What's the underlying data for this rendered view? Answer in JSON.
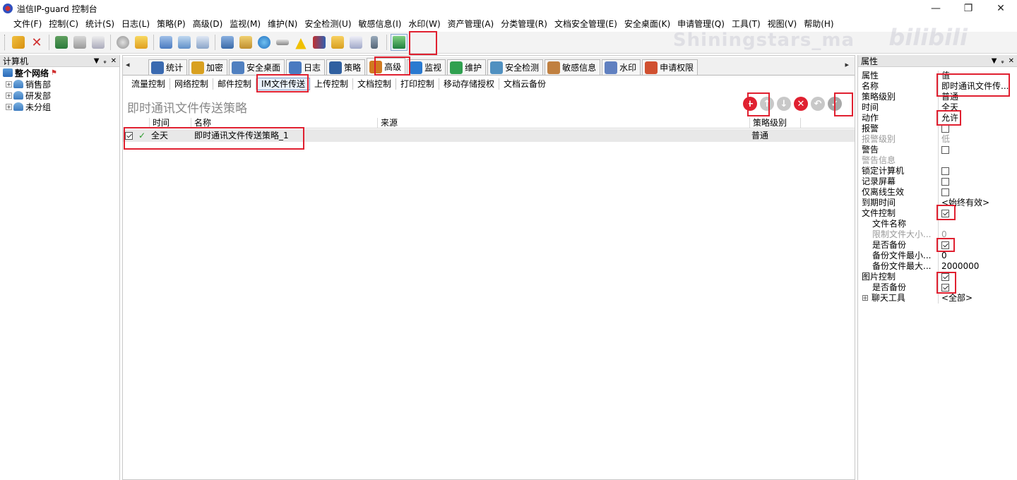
{
  "window": {
    "title": "溢信IP-guard 控制台",
    "controls": [
      "—",
      "❐",
      "✕"
    ]
  },
  "menu": [
    "文件(F)",
    "控制(C)",
    "统计(S)",
    "日志(L)",
    "策略(P)",
    "高级(D)",
    "监视(M)",
    "维护(N)",
    "安全检测(U)",
    "敏感信息(I)",
    "水印(W)",
    "资产管理(A)",
    "分类管理(R)",
    "文档安全管理(E)",
    "安全桌面(K)",
    "申请管理(Q)",
    "工具(T)",
    "视图(V)",
    "帮助(H)"
  ],
  "watermark": {
    "text": "Shiningstars_ma",
    "logo": "bilibili"
  },
  "left_panel": {
    "title": "计算机",
    "controls": [
      "▼",
      "ᵩ",
      "✕"
    ],
    "root": "整个网络",
    "groups": [
      "销售部",
      "研发部",
      "未分组"
    ]
  },
  "tabs": [
    {
      "label": "统计",
      "icon": "chart-icon",
      "color": "#3a6ab0"
    },
    {
      "label": "加密",
      "icon": "lock-icon",
      "color": "#d8a020"
    },
    {
      "label": "安全桌面",
      "icon": "desktop-icon",
      "color": "#5080c0"
    },
    {
      "label": "日志",
      "icon": "log-icon",
      "color": "#4a7ac0"
    },
    {
      "label": "策略",
      "icon": "policy-icon",
      "color": "#3060a0"
    },
    {
      "label": "高级",
      "icon": "advanced-icon",
      "color": "#d07a20"
    },
    {
      "label": "监视",
      "icon": "monitor-icon",
      "color": "#2a7ad0"
    },
    {
      "label": "维护",
      "icon": "maintain-icon",
      "color": "#30a050"
    },
    {
      "label": "安全检测",
      "icon": "security-check-icon",
      "color": "#5090c0"
    },
    {
      "label": "敏感信息",
      "icon": "sensitive-icon",
      "color": "#c08040"
    },
    {
      "label": "水印",
      "icon": "watermark-icon",
      "color": "#6080c0"
    },
    {
      "label": "申请权限",
      "icon": "request-icon",
      "color": "#d05030"
    }
  ],
  "subtabs": [
    "流量控制",
    "网络控制",
    "邮件控制",
    "IM文件传送",
    "上传控制",
    "文档控制",
    "打印控制",
    "移动存储授权",
    "文档云备份"
  ],
  "policy": {
    "title": "即时通讯文件传送策略",
    "columns": [
      "时间",
      "名称",
      "来源",
      "策略级别"
    ],
    "rows": [
      {
        "time": "全天",
        "name": "即时通讯文件传送策略_1",
        "source": "",
        "level": "普通"
      }
    ]
  },
  "right_panel": {
    "title": "属性",
    "controls": [
      "▼",
      "ᵩ",
      "✕"
    ],
    "header": {
      "name": "属性",
      "value": "值"
    },
    "rows": [
      {
        "name": "名称",
        "value": "即时通讯文件传...",
        "type": "text"
      },
      {
        "name": "策略级别",
        "value": "普通",
        "type": "text"
      },
      {
        "name": "时间",
        "value": "全天",
        "type": "text"
      },
      {
        "name": "动作",
        "value": "允许",
        "type": "text"
      },
      {
        "name": "报警",
        "value": "",
        "type": "check",
        "checked": false
      },
      {
        "name": "报警级别",
        "value": "低",
        "type": "text",
        "dim": true
      },
      {
        "name": "警告",
        "value": "",
        "type": "check",
        "checked": false
      },
      {
        "name": "警告信息",
        "value": "",
        "type": "text",
        "dim": true
      },
      {
        "name": "锁定计算机",
        "value": "",
        "type": "check",
        "checked": false
      },
      {
        "name": "记录屏幕",
        "value": "",
        "type": "check",
        "checked": false
      },
      {
        "name": "仅离线生效",
        "value": "",
        "type": "check",
        "checked": false
      },
      {
        "name": "到期时间",
        "value": "<始终有效>",
        "type": "text"
      },
      {
        "name": "文件控制",
        "value": "",
        "type": "check",
        "checked": true
      },
      {
        "name": "文件名称",
        "value": "",
        "type": "text",
        "indent": true
      },
      {
        "name": "限制文件大小...",
        "value": "0",
        "type": "text",
        "indent": true,
        "dim": true
      },
      {
        "name": "是否备份",
        "value": "",
        "type": "check",
        "checked": true,
        "indent": true
      },
      {
        "name": "备份文件最小...",
        "value": "0",
        "type": "text",
        "indent": true
      },
      {
        "name": "备份文件最大...",
        "value": "2000000",
        "type": "text",
        "indent": true
      },
      {
        "name": "图片控制",
        "value": "",
        "type": "check",
        "checked": true
      },
      {
        "name": "是否备份",
        "value": "",
        "type": "check",
        "checked": true,
        "indent": true
      },
      {
        "name": "聊天工具",
        "value": "<全部>",
        "type": "text",
        "expand": true
      }
    ]
  }
}
